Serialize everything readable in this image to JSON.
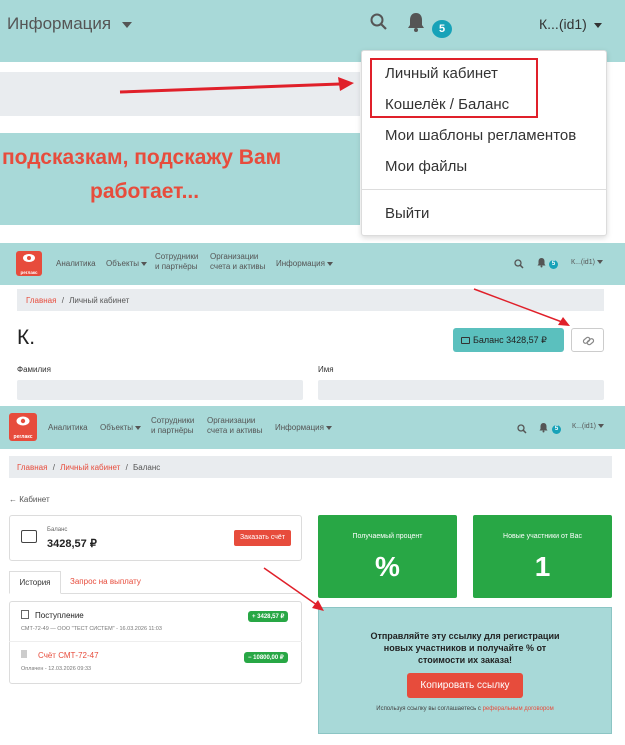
{
  "top": {
    "menu_label": "Информация",
    "notif_count": "5",
    "user_label": "К...(id1)",
    "dropdown": {
      "item1": "Личный кабинет",
      "item2": "Кошелёк / Баланс",
      "item3": "Мои шаблоны регламентов",
      "item4": "Мои файлы",
      "item5": "Выйти"
    },
    "banner_line1": "подсказкам,  подскажу Вам",
    "banner_line2": "работает..."
  },
  "nav": {
    "logo_text": "реглакс",
    "analytics": "Аналитика",
    "objects": "Объекты",
    "staff_line1": "Сотрудники",
    "staff_line2": "и партнёры",
    "orgs_line1": "Организации",
    "orgs_line2": "счета и активы",
    "info": "Информация",
    "notif_count": "5",
    "user": "К...(id1)"
  },
  "profile": {
    "crumb_home": "Главная",
    "crumb_sep": "/",
    "crumb_current": "Личный кабинет",
    "name": "К.",
    "balance_button": "Баланс 3428,57 ₽",
    "surname_label": "Фамилия",
    "firstname_label": "Имя"
  },
  "balance": {
    "crumb_home": "Главная",
    "crumb_sep": "/",
    "crumb_cabinet": "Личный кабинет",
    "crumb_current": "Баланс",
    "back": "← Кабинет",
    "card_label": "Баланс",
    "card_value": "3428,57 ₽",
    "order_button": "Заказать счёт",
    "tab_history": "История",
    "tab_payout": "Запрос на выплату",
    "tx1_title": "Поступление",
    "tx1_sub": "СМТ-72-49 — ООО \"ТЕСТ СИСТЕМ\" - 16.03.2026 11:03",
    "tx1_amount": "+ 3428,57 ₽",
    "tx2_title": "Счёт СМТ-72-47",
    "tx2_sub": "Оплачен - 12.03.2026 09:33",
    "tx2_amount": "− 10800,00 ₽",
    "tile1_label": "Получаемый процент",
    "tile1_value": "%",
    "tile2_label": "Новые участники от Вас",
    "tile2_value": "1",
    "ref_text_line1": "Отправляйте эту ссылку для регистрации",
    "ref_text_line2": "новых участников и получайте % от",
    "ref_text_line3": "стоимости их заказа!",
    "copy_button": "Копировать ссылку",
    "agree_prefix": "Используя ссылку вы соглашаетесь с",
    "agree_link": "реферальным договором"
  },
  "colors": {
    "accent": "#e74c3c",
    "teal": "#a8d9d8",
    "green": "#28a745",
    "badge": "#17a2b8"
  }
}
